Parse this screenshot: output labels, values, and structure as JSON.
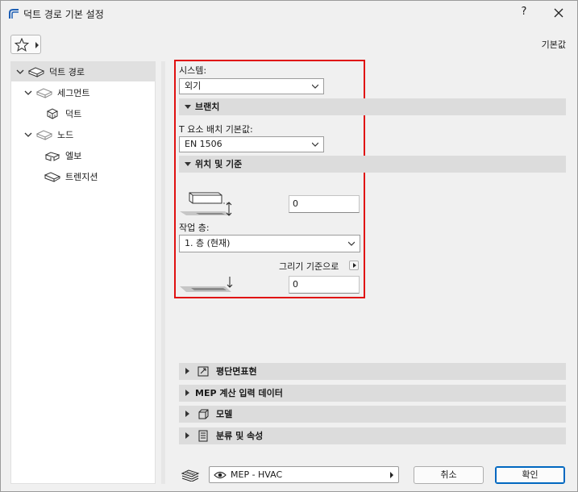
{
  "window": {
    "title": "덕트 경로 기본 설정",
    "help_label": "?"
  },
  "header": {
    "default_label": "기본값"
  },
  "tree": {
    "items": [
      {
        "label": "덕트 경로",
        "level": 0,
        "expanded": true,
        "selected": true
      },
      {
        "label": "세그먼트",
        "level": 1,
        "expanded": true
      },
      {
        "label": "덕트",
        "level": 2
      },
      {
        "label": "노드",
        "level": 1,
        "expanded": true
      },
      {
        "label": "엘보",
        "level": 2
      },
      {
        "label": "트렌지션",
        "level": 1
      }
    ]
  },
  "settings": {
    "system_label": "시스템:",
    "system_value": "외기",
    "branch_section": "브랜치",
    "t_placement_label": "T 요소 배치 기본값:",
    "t_placement_value": "EN 1506",
    "position_section": "위치 및 기준",
    "offset_value": "0",
    "work_floor_label": "작업 층:",
    "work_floor_value": "1. 층 (현재)",
    "drawing_ref_label": "그리기 기준으로",
    "drawing_ref_value": "0"
  },
  "collapsed_sections": [
    {
      "label": "평단면표현",
      "icon": "floor-plan-section-icon"
    },
    {
      "label": "MEP 계산 입력 데이터",
      "icon": ""
    },
    {
      "label": "모델",
      "icon": "model-cube-icon"
    },
    {
      "label": "분류 및 속성",
      "icon": "classification-list-icon"
    }
  ],
  "footer": {
    "view_value": "MEP - HVAC",
    "cancel_label": "취소",
    "ok_label": "확인"
  },
  "colors": {
    "highlight_border": "#e01010",
    "section_bg": "#dcdcdc",
    "dialog_bg": "#f0f0f0",
    "primary_button_border": "#0067c0"
  }
}
